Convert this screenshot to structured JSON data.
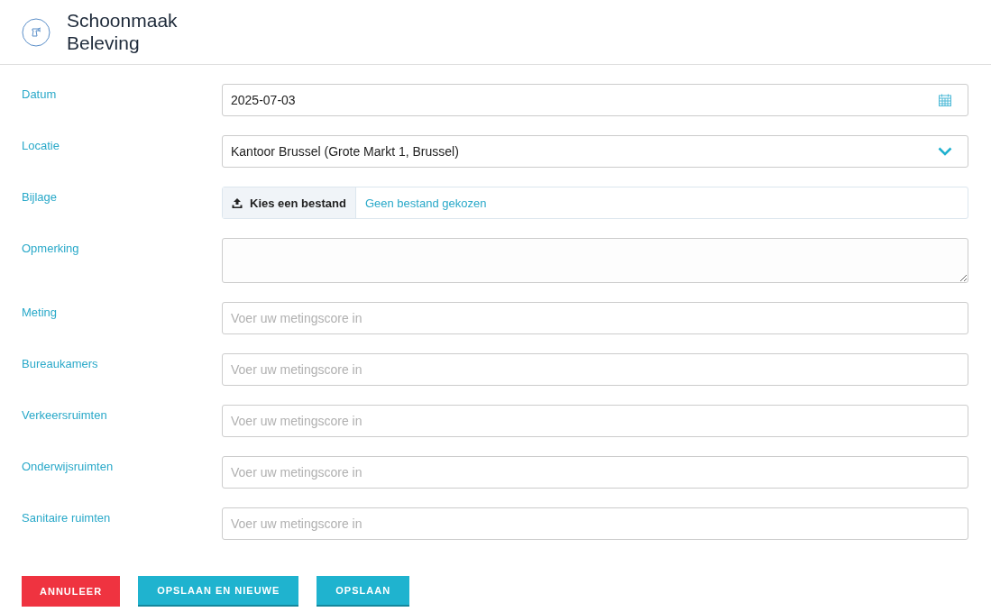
{
  "header": {
    "title": "Schoonmaak",
    "subtitle": "Beleving"
  },
  "fields": [
    {
      "label": "Datum",
      "kind": "date",
      "value": "2025-07-03"
    },
    {
      "label": "Locatie",
      "kind": "select",
      "value": "Kantoor Brussel (Grote Markt 1, Brussel)"
    },
    {
      "label": "Bijlage",
      "kind": "file",
      "button": "Kies een bestand",
      "value": "Geen bestand gekozen"
    },
    {
      "label": "Opmerking",
      "kind": "textarea"
    },
    {
      "label": "Meting",
      "kind": "text",
      "placeholder": "Voer uw metingscore in"
    },
    {
      "label": "Bureaukamers",
      "kind": "text",
      "placeholder": "Voer uw metingscore in"
    },
    {
      "label": "Verkeersruimten",
      "kind": "text",
      "placeholder": "Voer uw metingscore in"
    },
    {
      "label": "Onderwijsruimten",
      "kind": "text",
      "placeholder": "Voer uw metingscore in"
    },
    {
      "label": "Sanitaire ruimten",
      "kind": "text",
      "placeholder": "Voer uw metingscore in"
    }
  ],
  "buttons": [
    {
      "label": "ANNULEER",
      "kind": "danger"
    },
    {
      "label": "OPSLAAN EN NIEUWE",
      "kind": "primary"
    },
    {
      "label": "OPSLAAN",
      "kind": "primary"
    }
  ]
}
